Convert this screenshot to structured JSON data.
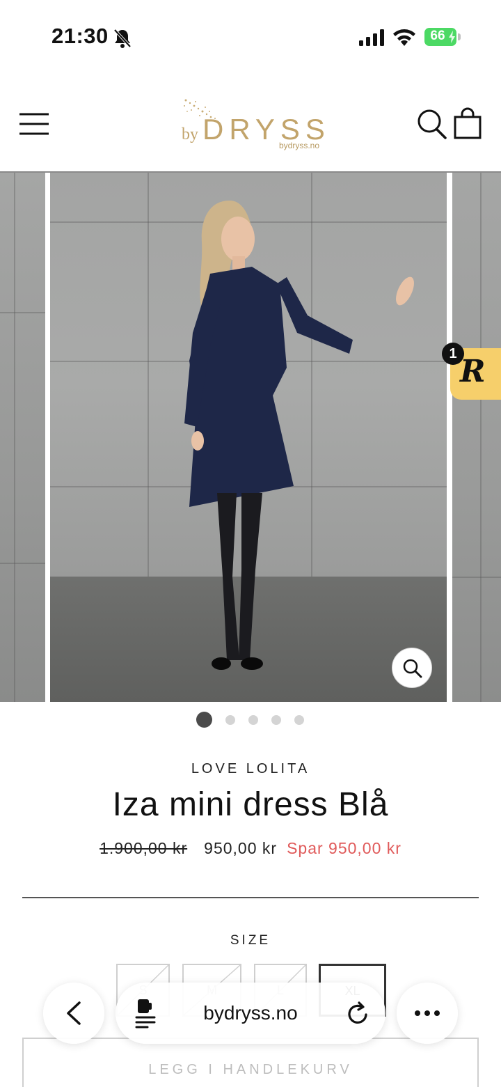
{
  "status_bar": {
    "time": "21:30",
    "battery": "66",
    "icons": [
      "bell-slash-icon",
      "cellular-signal-icon",
      "wifi-icon",
      "battery-charging-icon"
    ]
  },
  "header": {
    "logo_prefix": "by",
    "logo_main": "DRYSS",
    "logo_sub": "bydryss.no",
    "brand_color": "#c2a46b",
    "icons": [
      "menu-icon",
      "search-icon",
      "shopping-bag-icon"
    ]
  },
  "gallery": {
    "slide_count": 5,
    "active_index": 0,
    "zoom_icon": "zoom-magnifier-icon"
  },
  "rewards": {
    "badge_count": "1",
    "letter": "R",
    "color": "#f6cf6b"
  },
  "product": {
    "vendor": "LOVE LOLITA",
    "title": "Iza mini dress Blå",
    "price_original": "1.900,00 kr",
    "price_current": "950,00 kr",
    "savings": "Spar 950,00 kr",
    "savings_color": "#e05a5a",
    "size_label": "SIZE",
    "sizes": [
      {
        "label": "S",
        "available": false,
        "selected": false
      },
      {
        "label": "M",
        "available": false,
        "selected": false
      },
      {
        "label": "L",
        "available": false,
        "selected": false
      },
      {
        "label": "XL",
        "available": true,
        "selected": true
      }
    ],
    "add_to_cart": "LEGG I HANDLEKURV"
  },
  "browser": {
    "address": "bydryss.no",
    "icons": [
      "back-chevron-icon",
      "reader-mode-icon",
      "reload-icon",
      "more-icon"
    ]
  }
}
